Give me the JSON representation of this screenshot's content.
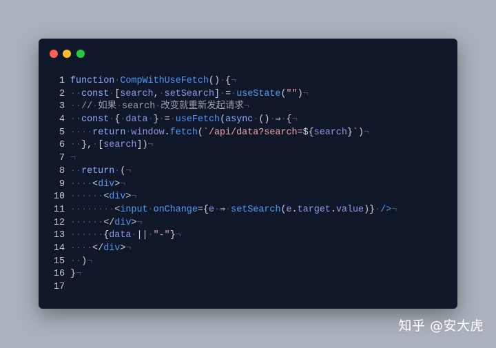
{
  "window": {
    "controls": [
      "close",
      "minimize",
      "maximize"
    ],
    "colors": {
      "close": "#ff5f57",
      "minimize": "#febc2e",
      "maximize": "#28c840",
      "background": "#0f1729"
    }
  },
  "code": {
    "lines": [
      {
        "n": "1",
        "tokens": [
          [
            "kw",
            "function"
          ],
          [
            "ws",
            "·"
          ],
          [
            "fn",
            "CompWithUseFetch"
          ],
          [
            "pn",
            "()"
          ],
          [
            "ws",
            "·"
          ],
          [
            "pn",
            "{"
          ],
          [
            "ws",
            "¬"
          ]
        ]
      },
      {
        "n": "2",
        "tokens": [
          [
            "ws",
            "··"
          ],
          [
            "kw",
            "const"
          ],
          [
            "ws",
            "·"
          ],
          [
            "pn",
            "["
          ],
          [
            "id",
            "search"
          ],
          [
            "pn",
            ","
          ],
          [
            "ws",
            "·"
          ],
          [
            "id",
            "setSearch"
          ],
          [
            "pn",
            "]"
          ],
          [
            "ws",
            "·"
          ],
          [
            "op",
            "="
          ],
          [
            "ws",
            "·"
          ],
          [
            "fn",
            "useState"
          ],
          [
            "pn",
            "("
          ],
          [
            "str",
            "\"\""
          ],
          [
            "pn",
            ")"
          ],
          [
            "ws",
            "¬"
          ]
        ]
      },
      {
        "n": "3",
        "tokens": [
          [
            "ws",
            "··"
          ],
          [
            "cm",
            "//"
          ],
          [
            "ws",
            "·"
          ],
          [
            "cm",
            "如果"
          ],
          [
            "ws",
            "·"
          ],
          [
            "cm",
            "search"
          ],
          [
            "ws",
            "·"
          ],
          [
            "cm",
            "改变就重新发起请求"
          ],
          [
            "ws",
            "¬"
          ]
        ]
      },
      {
        "n": "4",
        "tokens": [
          [
            "ws",
            "··"
          ],
          [
            "kw",
            "const"
          ],
          [
            "ws",
            "·"
          ],
          [
            "pn",
            "{"
          ],
          [
            "ws",
            "·"
          ],
          [
            "id",
            "data"
          ],
          [
            "ws",
            "·"
          ],
          [
            "pn",
            "}"
          ],
          [
            "ws",
            "·"
          ],
          [
            "op",
            "="
          ],
          [
            "ws",
            "·"
          ],
          [
            "fn",
            "useFetch"
          ],
          [
            "pn",
            "("
          ],
          [
            "kw",
            "async"
          ],
          [
            "ws",
            "·"
          ],
          [
            "pn",
            "()"
          ],
          [
            "ws",
            "·"
          ],
          [
            "op",
            "⇒"
          ],
          [
            "ws",
            "·"
          ],
          [
            "pn",
            "{"
          ],
          [
            "ws",
            "¬"
          ]
        ]
      },
      {
        "n": "5",
        "tokens": [
          [
            "ws",
            "····"
          ],
          [
            "kw",
            "return"
          ],
          [
            "ws",
            "·"
          ],
          [
            "id",
            "window"
          ],
          [
            "pn",
            "."
          ],
          [
            "fn",
            "fetch"
          ],
          [
            "pn",
            "("
          ],
          [
            "str",
            "`/api/data?search="
          ],
          [
            "pn",
            "${"
          ],
          [
            "id",
            "search"
          ],
          [
            "pn",
            "}"
          ],
          [
            "str",
            "`"
          ],
          [
            "pn",
            ")"
          ],
          [
            "ws",
            "¬"
          ]
        ]
      },
      {
        "n": "6",
        "tokens": [
          [
            "ws",
            "··"
          ],
          [
            "pn",
            "},"
          ],
          [
            "ws",
            "·"
          ],
          [
            "pn",
            "["
          ],
          [
            "id",
            "search"
          ],
          [
            "pn",
            "])"
          ],
          [
            "ws",
            "¬"
          ]
        ]
      },
      {
        "n": "7",
        "tokens": [
          [
            "ws",
            "¬"
          ]
        ]
      },
      {
        "n": "8",
        "tokens": [
          [
            "ws",
            "··"
          ],
          [
            "kw",
            "return"
          ],
          [
            "ws",
            "·"
          ],
          [
            "pn",
            "("
          ],
          [
            "ws",
            "¬"
          ]
        ]
      },
      {
        "n": "9",
        "tokens": [
          [
            "ws",
            "····"
          ],
          [
            "pn",
            "<"
          ],
          [
            "tag",
            "div"
          ],
          [
            "pn",
            ">"
          ],
          [
            "ws",
            "¬"
          ]
        ]
      },
      {
        "n": "10",
        "tokens": [
          [
            "ws",
            "······"
          ],
          [
            "pn",
            "<"
          ],
          [
            "tag",
            "div"
          ],
          [
            "pn",
            ">"
          ],
          [
            "ws",
            "¬"
          ]
        ]
      },
      {
        "n": "11",
        "tokens": [
          [
            "ws",
            "········"
          ],
          [
            "pn",
            "<"
          ],
          [
            "tag",
            "input"
          ],
          [
            "ws",
            "·"
          ],
          [
            "attr",
            "onChange"
          ],
          [
            "pn",
            "={"
          ],
          [
            "id",
            "e"
          ],
          [
            "ws",
            "·"
          ],
          [
            "op",
            "⇒"
          ],
          [
            "ws",
            "·"
          ],
          [
            "fn",
            "setSearch"
          ],
          [
            "pn",
            "("
          ],
          [
            "id",
            "e"
          ],
          [
            "pn",
            "."
          ],
          [
            "id",
            "target"
          ],
          [
            "pn",
            "."
          ],
          [
            "id",
            "value"
          ],
          [
            "pn",
            ")}"
          ],
          [
            "ws",
            "·"
          ],
          [
            "tag",
            "/>"
          ],
          [
            "ws",
            "¬"
          ]
        ]
      },
      {
        "n": "12",
        "tokens": [
          [
            "ws",
            "······"
          ],
          [
            "pn",
            "</"
          ],
          [
            "tag",
            "div"
          ],
          [
            "pn",
            ">"
          ],
          [
            "ws",
            "¬"
          ]
        ]
      },
      {
        "n": "13",
        "tokens": [
          [
            "ws",
            "······"
          ],
          [
            "pn",
            "{"
          ],
          [
            "id",
            "data"
          ],
          [
            "ws",
            "·"
          ],
          [
            "op",
            "||"
          ],
          [
            "ws",
            "·"
          ],
          [
            "str",
            "\"-\""
          ],
          [
            "pn",
            "}"
          ],
          [
            "ws",
            "¬"
          ]
        ]
      },
      {
        "n": "14",
        "tokens": [
          [
            "ws",
            "····"
          ],
          [
            "pn",
            "</"
          ],
          [
            "tag",
            "div"
          ],
          [
            "pn",
            ">"
          ],
          [
            "ws",
            "¬"
          ]
        ]
      },
      {
        "n": "15",
        "tokens": [
          [
            "ws",
            "··"
          ],
          [
            "pn",
            ")"
          ],
          [
            "ws",
            "¬"
          ]
        ]
      },
      {
        "n": "16",
        "tokens": [
          [
            "pn",
            "}"
          ],
          [
            "ws",
            "¬"
          ]
        ]
      },
      {
        "n": "17",
        "tokens": []
      }
    ]
  },
  "watermark": "知乎 @安大虎"
}
